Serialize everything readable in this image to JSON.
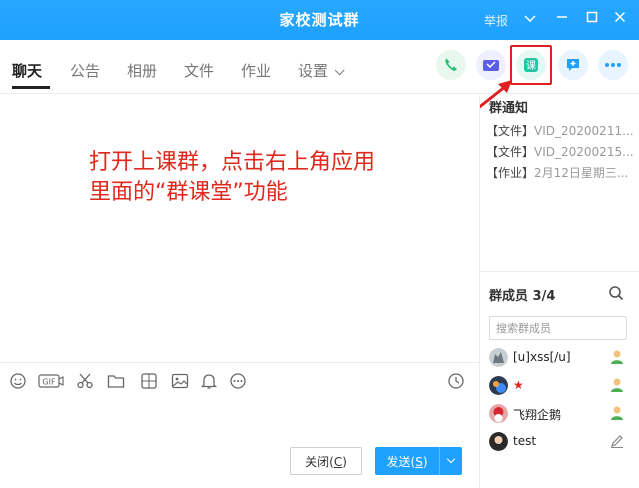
{
  "window": {
    "title": "家校测试群",
    "report_label": "举报"
  },
  "tabs": [
    {
      "label": "聊天",
      "active": true
    },
    {
      "label": "公告"
    },
    {
      "label": "相册"
    },
    {
      "label": "文件"
    },
    {
      "label": "作业"
    },
    {
      "label": "设置"
    }
  ],
  "toolbar_icons": [
    "phone-call-icon",
    "video-call-icon",
    "group-classroom-icon",
    "add-app-icon",
    "more-icon"
  ],
  "annotation": {
    "line1": "打开上课群，点击右上角应用",
    "line2": "里面的“群课堂”功能"
  },
  "notice": {
    "title": "群通知",
    "items": [
      {
        "tag": "【文件】",
        "text": "VID_20200211..."
      },
      {
        "tag": "【文件】",
        "text": "VID_20200215..."
      },
      {
        "tag": "【作业】",
        "text": "2月12日星期三..."
      }
    ]
  },
  "members": {
    "title": "群成员 3/4",
    "search_placeholder": "搜索群成员",
    "list": [
      {
        "name": "[u]xss[/u]"
      },
      {
        "name": "★"
      },
      {
        "name": "飞翔企鹅"
      },
      {
        "name": "test"
      }
    ]
  },
  "input_toolbar": [
    "emoji-icon",
    "gif-icon",
    "scissors-icon",
    "folder-icon",
    "sticker-icon",
    "image-icon",
    "bell-icon",
    "more-circle-icon",
    "history-clock-icon"
  ],
  "buttons": {
    "close": "关闭",
    "close_key": "C",
    "send": "发送",
    "send_key": "S"
  },
  "colors": {
    "titlebar": "#1ea1ff",
    "annotation": "#e0281e",
    "highlight": "#e02020"
  }
}
